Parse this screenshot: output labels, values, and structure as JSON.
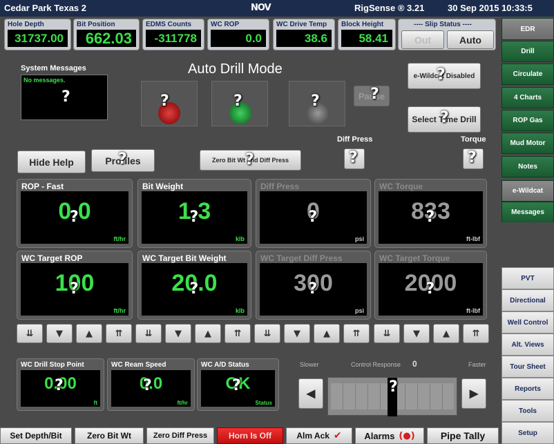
{
  "header": {
    "site": "Cedar Park Texas 2",
    "logo": "NOV",
    "app": "RigSense ® 3.21",
    "datetime": "30 Sep 2015 10:33:5"
  },
  "indicators": [
    {
      "label": "Hole Depth",
      "value": "31737.00"
    },
    {
      "label": "Bit Position",
      "value": "662.03"
    },
    {
      "label": "EDMS Counts",
      "value": "-311778"
    },
    {
      "label": "WC ROP",
      "value": "0.0"
    },
    {
      "label": "WC Drive Temp",
      "value": "38.6"
    },
    {
      "label": "Block Height",
      "value": "58.41"
    }
  ],
  "slip": {
    "label": "---- Slip Status ----",
    "out": "Out",
    "auto": "Auto"
  },
  "main": {
    "mode_title": "Auto Drill Mode",
    "system_messages_label": "System Messages",
    "system_messages_text": "No messages.",
    "ewildcat_btn": "e-Wildcat Disabled",
    "pause_btn": "Pause",
    "select_time_drill_btn": "Select Time Drill",
    "hide_help_btn": "Hide Help",
    "profiles_btn": "Profiles",
    "zero_btn": "Zero Bit Wt and Diff Press",
    "diff_press_label": "Diff Press",
    "torque_label": "Torque",
    "help_mark": "?"
  },
  "panels": [
    {
      "label": "ROP - Fast",
      "value": "0.0",
      "unit": "ft/hr"
    },
    {
      "label": "Bit Weight",
      "value": "1.3",
      "unit": "klb"
    },
    {
      "label": "Diff Press",
      "value": "0",
      "unit": "psi"
    },
    {
      "label": "WC Torque",
      "value": "833",
      "unit": "ft-lbf"
    },
    {
      "label": "WC Target ROP",
      "value": "100",
      "unit": "ft/hr"
    },
    {
      "label": "WC Target Bit Weight",
      "value": "20.0",
      "unit": "klb"
    },
    {
      "label": "WC Target Diff Press",
      "value": "300",
      "unit": "psi"
    },
    {
      "label": "WC Target Torque",
      "value": "2000",
      "unit": "ft-lbf"
    }
  ],
  "small": [
    {
      "label": "WC Drill Stop Point",
      "value": "0.00",
      "unit": "ft"
    },
    {
      "label": "WC Ream Speed",
      "value": "0.0",
      "unit": "ft/hr"
    },
    {
      "label": "WC A/D Status",
      "value": "OK",
      "unit": "Status"
    }
  ],
  "control": {
    "slower": "Slower",
    "label": "Control Response",
    "value": "0",
    "faster": "Faster"
  },
  "sidebar_top": [
    "EDR",
    "Drill",
    "Circulate",
    "4 Charts",
    "ROP Gas",
    "Mud Motor",
    "Notes",
    "e-Wildcat",
    "Messages"
  ],
  "sidebar_bottom": [
    "PVT",
    "Directional",
    "Well Control",
    "Alt. Views",
    "Tour Sheet",
    "Reports",
    "Tools",
    "Setup"
  ],
  "bottom": {
    "set_depth": "Set Depth/Bit",
    "zero_bit": "Zero Bit Wt",
    "zero_diff": "Zero Diff Press",
    "horn": "Horn Is Off",
    "alm_ack": "Alm Ack",
    "alarms": "Alarms",
    "pipe_tally": "Pipe Tally"
  },
  "colors": {
    "accent_green": "#3be04a",
    "sidebar_green": "#2f7a4a",
    "horn_red": "#e02020",
    "topbar": "#1c2c4c"
  }
}
